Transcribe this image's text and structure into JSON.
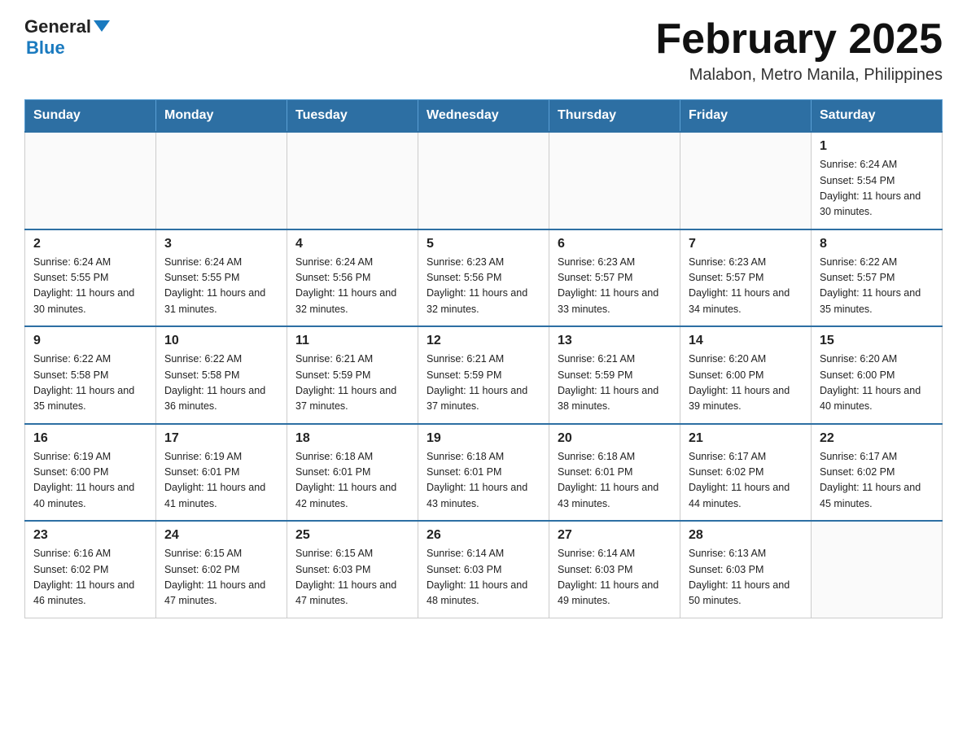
{
  "logo": {
    "text_general": "General",
    "text_blue": "Blue"
  },
  "header": {
    "month_title": "February 2025",
    "location": "Malabon, Metro Manila, Philippines"
  },
  "weekdays": [
    "Sunday",
    "Monday",
    "Tuesday",
    "Wednesday",
    "Thursday",
    "Friday",
    "Saturday"
  ],
  "weeks": [
    [
      {
        "day": "",
        "info": ""
      },
      {
        "day": "",
        "info": ""
      },
      {
        "day": "",
        "info": ""
      },
      {
        "day": "",
        "info": ""
      },
      {
        "day": "",
        "info": ""
      },
      {
        "day": "",
        "info": ""
      },
      {
        "day": "1",
        "info": "Sunrise: 6:24 AM\nSunset: 5:54 PM\nDaylight: 11 hours and 30 minutes."
      }
    ],
    [
      {
        "day": "2",
        "info": "Sunrise: 6:24 AM\nSunset: 5:55 PM\nDaylight: 11 hours and 30 minutes."
      },
      {
        "day": "3",
        "info": "Sunrise: 6:24 AM\nSunset: 5:55 PM\nDaylight: 11 hours and 31 minutes."
      },
      {
        "day": "4",
        "info": "Sunrise: 6:24 AM\nSunset: 5:56 PM\nDaylight: 11 hours and 32 minutes."
      },
      {
        "day": "5",
        "info": "Sunrise: 6:23 AM\nSunset: 5:56 PM\nDaylight: 11 hours and 32 minutes."
      },
      {
        "day": "6",
        "info": "Sunrise: 6:23 AM\nSunset: 5:57 PM\nDaylight: 11 hours and 33 minutes."
      },
      {
        "day": "7",
        "info": "Sunrise: 6:23 AM\nSunset: 5:57 PM\nDaylight: 11 hours and 34 minutes."
      },
      {
        "day": "8",
        "info": "Sunrise: 6:22 AM\nSunset: 5:57 PM\nDaylight: 11 hours and 35 minutes."
      }
    ],
    [
      {
        "day": "9",
        "info": "Sunrise: 6:22 AM\nSunset: 5:58 PM\nDaylight: 11 hours and 35 minutes."
      },
      {
        "day": "10",
        "info": "Sunrise: 6:22 AM\nSunset: 5:58 PM\nDaylight: 11 hours and 36 minutes."
      },
      {
        "day": "11",
        "info": "Sunrise: 6:21 AM\nSunset: 5:59 PM\nDaylight: 11 hours and 37 minutes."
      },
      {
        "day": "12",
        "info": "Sunrise: 6:21 AM\nSunset: 5:59 PM\nDaylight: 11 hours and 37 minutes."
      },
      {
        "day": "13",
        "info": "Sunrise: 6:21 AM\nSunset: 5:59 PM\nDaylight: 11 hours and 38 minutes."
      },
      {
        "day": "14",
        "info": "Sunrise: 6:20 AM\nSunset: 6:00 PM\nDaylight: 11 hours and 39 minutes."
      },
      {
        "day": "15",
        "info": "Sunrise: 6:20 AM\nSunset: 6:00 PM\nDaylight: 11 hours and 40 minutes."
      }
    ],
    [
      {
        "day": "16",
        "info": "Sunrise: 6:19 AM\nSunset: 6:00 PM\nDaylight: 11 hours and 40 minutes."
      },
      {
        "day": "17",
        "info": "Sunrise: 6:19 AM\nSunset: 6:01 PM\nDaylight: 11 hours and 41 minutes."
      },
      {
        "day": "18",
        "info": "Sunrise: 6:18 AM\nSunset: 6:01 PM\nDaylight: 11 hours and 42 minutes."
      },
      {
        "day": "19",
        "info": "Sunrise: 6:18 AM\nSunset: 6:01 PM\nDaylight: 11 hours and 43 minutes."
      },
      {
        "day": "20",
        "info": "Sunrise: 6:18 AM\nSunset: 6:01 PM\nDaylight: 11 hours and 43 minutes."
      },
      {
        "day": "21",
        "info": "Sunrise: 6:17 AM\nSunset: 6:02 PM\nDaylight: 11 hours and 44 minutes."
      },
      {
        "day": "22",
        "info": "Sunrise: 6:17 AM\nSunset: 6:02 PM\nDaylight: 11 hours and 45 minutes."
      }
    ],
    [
      {
        "day": "23",
        "info": "Sunrise: 6:16 AM\nSunset: 6:02 PM\nDaylight: 11 hours and 46 minutes."
      },
      {
        "day": "24",
        "info": "Sunrise: 6:15 AM\nSunset: 6:02 PM\nDaylight: 11 hours and 47 minutes."
      },
      {
        "day": "25",
        "info": "Sunrise: 6:15 AM\nSunset: 6:03 PM\nDaylight: 11 hours and 47 minutes."
      },
      {
        "day": "26",
        "info": "Sunrise: 6:14 AM\nSunset: 6:03 PM\nDaylight: 11 hours and 48 minutes."
      },
      {
        "day": "27",
        "info": "Sunrise: 6:14 AM\nSunset: 6:03 PM\nDaylight: 11 hours and 49 minutes."
      },
      {
        "day": "28",
        "info": "Sunrise: 6:13 AM\nSunset: 6:03 PM\nDaylight: 11 hours and 50 minutes."
      },
      {
        "day": "",
        "info": ""
      }
    ]
  ]
}
